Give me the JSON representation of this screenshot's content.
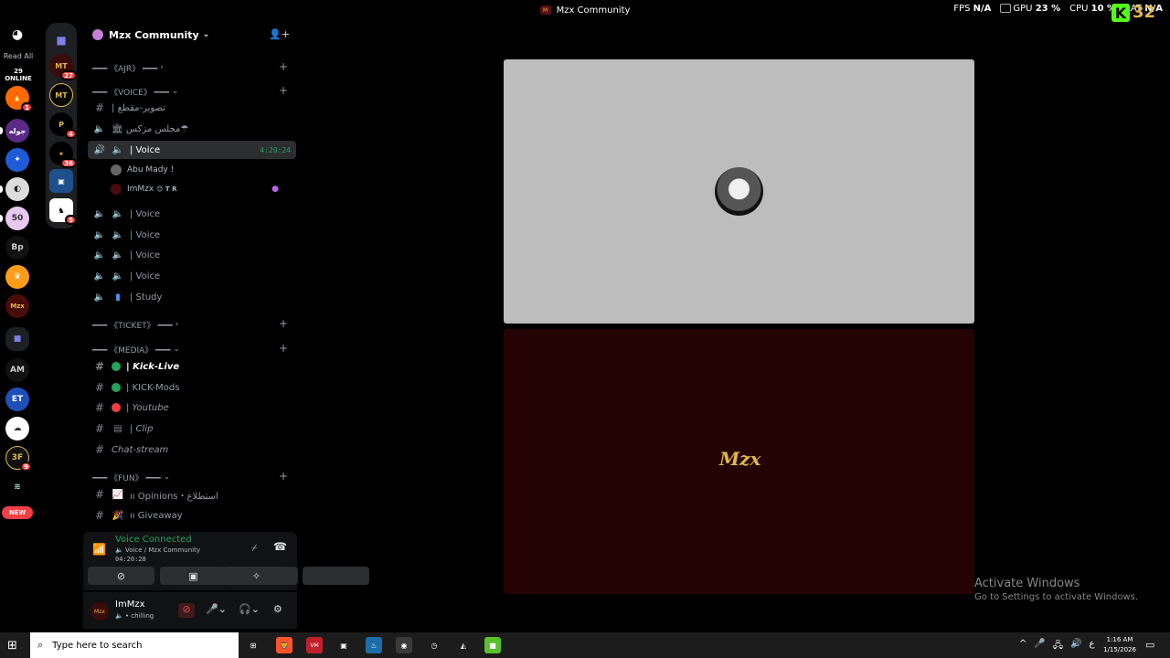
{
  "window": {
    "title": "Mzx Community"
  },
  "overlay": {
    "fps_label": "FPS",
    "fps_value": "N/A",
    "gpu_label": "GPU",
    "gpu_value": "23 %",
    "cpu_label": "CPU",
    "cpu_value": "10 %",
    "lat_label": "LAT",
    "lat_value": "N/A",
    "k_label": "K",
    "k_number": "32"
  },
  "rail": {
    "read_all": "Read All",
    "online": "29 ONLINE",
    "servers": [
      {
        "label": "🔥",
        "badge": "1"
      },
      {
        "label": "جوله",
        "badge": ""
      },
      {
        "label": "✦",
        "badge": ""
      },
      {
        "label": "◐",
        "badge": ""
      },
      {
        "label": "50",
        "badge": ""
      },
      {
        "label": "Bp",
        "badge": ""
      },
      {
        "label": "♛",
        "badge": ""
      },
      {
        "label": "Mzx",
        "badge": ""
      },
      {
        "label": "■",
        "badge": ""
      },
      {
        "label": "AM",
        "badge": ""
      },
      {
        "label": "ET",
        "badge": ""
      },
      {
        "label": "☁",
        "badge": ""
      },
      {
        "label": "3F",
        "badge": "9"
      },
      {
        "label": "≋",
        "badge": ""
      },
      {
        "label": "NEW",
        "badge": ""
      }
    ],
    "folder_servers": [
      {
        "label": "MT",
        "badge": "27"
      },
      {
        "label": "MT",
        "badge": ""
      },
      {
        "label": "P",
        "badge": "4"
      },
      {
        "label": "✶",
        "badge": "36"
      },
      {
        "label": "▣",
        "badge": ""
      },
      {
        "label": "♞",
        "badge": "5"
      }
    ]
  },
  "sidebar": {
    "guild_name": "Mzx Community",
    "categories": {
      "ajr": "━━━ 《AJR》 ━━━",
      "voice": "━━━ 《VOICE》 ━━━",
      "ticket": "━━━ 《TICKET》 ━━━",
      "media": "━━━ 《MEDIA》 ━━━",
      "fun": "━━━ 《FUN》 ━━━"
    },
    "channels": {
      "taswir": "| تصوير-مقطع",
      "majlis": "🏛 مجلس مزكس☂",
      "voice_active": "| Voice",
      "voice_timer": "4:20:24",
      "voice2": "| Voice",
      "voice3": "| Voice",
      "voice4": "| Voice",
      "voice5": "| Voice",
      "study": "| Study",
      "kick_live": "| Kick-Live",
      "kick_mods": "| KICK-Mods",
      "youtube": "| Youtube",
      "clip": "| Clip",
      "chat_stream": "Chat-stream",
      "opinions": "ıı Opinions・استطلاع",
      "giveaway": "ıı Giveaway"
    },
    "voice_users": [
      {
        "name": "Abu Mady !"
      },
      {
        "name": "ImMzx",
        "tag": "😊 T R"
      }
    ]
  },
  "voice_panel": {
    "status": "Voice Connected",
    "channel": "Voice / Mzx Community",
    "elapsed": "04:20:28"
  },
  "user_panel": {
    "name": "ImMzx",
    "status": "chilling"
  },
  "stream": {
    "logo_text": "Mzx"
  },
  "activation": {
    "line1": "Activate Windows",
    "line2": "Go to Settings to activate Windows."
  },
  "taskbar": {
    "search_placeholder": "Type here to search",
    "time": "1:16 AM",
    "date": "1/15/2026",
    "lang": "ع",
    "apps": [
      "⊞",
      "🦁",
      "VM",
      "▣",
      "♨",
      "◉",
      "◷",
      "◭",
      "■"
    ]
  }
}
